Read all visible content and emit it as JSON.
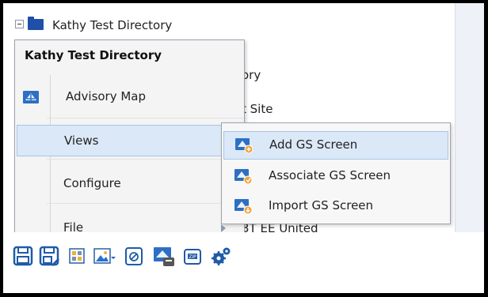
{
  "tree": {
    "root_label": "Kathy Test Directory",
    "row2_label": "ory",
    "row3_label": "t Site",
    "row4_label": "3T EE United"
  },
  "context_menu": {
    "title": "Kathy Test Directory",
    "items": [
      {
        "label": "Advisory Map",
        "icon": "advisory-map-icon",
        "has_submenu": false
      },
      {
        "label": "Views",
        "icon": "",
        "has_submenu": true,
        "highlighted": true
      },
      {
        "label": "Configure",
        "icon": "",
        "has_submenu": true
      },
      {
        "label": "File",
        "icon": "",
        "has_submenu": true
      }
    ]
  },
  "submenu": {
    "items": [
      {
        "label": "Add GS Screen",
        "icon": "add-gs-screen-icon",
        "highlighted": true
      },
      {
        "label": "Associate GS Screen",
        "icon": "associate-gs-screen-icon"
      },
      {
        "label": "Import GS Screen",
        "icon": "import-gs-screen-icon"
      }
    ]
  },
  "toolbar": {
    "buttons": [
      "save-icon",
      "save-as-icon",
      "grid-layout-icon",
      "image-dropdown-icon",
      "clipboard-icon",
      "network-screen-icon",
      "zip-icon",
      "settings-gears-icon"
    ]
  },
  "colors": {
    "accent_blue": "#1f5ba8",
    "menu_highlight": "#dbe8f7",
    "menu_bg": "#f4f4f4"
  }
}
